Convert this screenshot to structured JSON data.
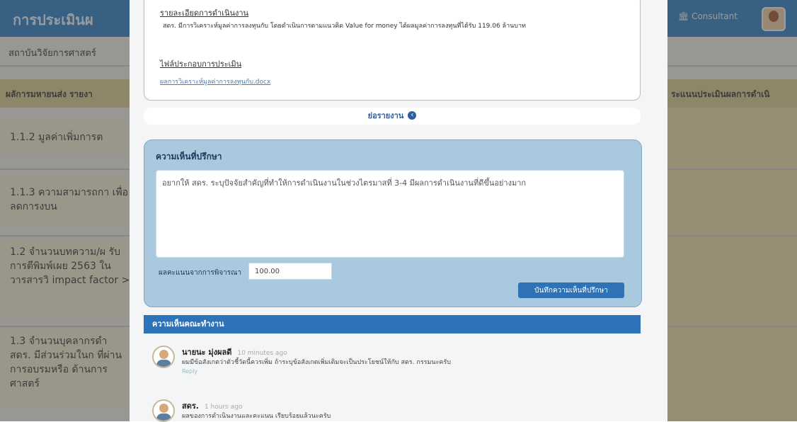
{
  "background": {
    "header_title": "การประเมินผ",
    "user_label": "Consultant",
    "subtitle": "สถาบันวิจัยการศาสตร์",
    "band_left": "ผลัการมหายนส่ง รายงา",
    "band_right": "ระแนนประเมินผลการดำเนิ",
    "rows": [
      {
        "text": "1.1.2 มูลค่าเพิ่มการต"
      },
      {
        "text": "1.1.3 ความสามารถกา เพื่อลดการงบน"
      },
      {
        "text": "1.2 จำนวนบทความ/ผ รับการตีพิมพ์เผย 2563 ในวารสารวิ impact factor >"
      },
      {
        "text": "1.3 จำนวนบุคลากรดำ สดร. มีส่วนร่วมในก ที่ผ่านการอบรมหรือ ด้านการศาสตร์"
      }
    ]
  },
  "modal": {
    "result_label": "รายละเอียดการดำเนินงาน",
    "result_text": "สดร. มีการวิเคราะห์มูลค่าการลงทุนกับ โดยดำเนินการตามแนวคิด Value for money ได้ผลมูลค่าการลงทุนที่ได้รับ 119.06 ล้านบาท",
    "attachment_label": "ไฟล์ประกอบการประเมิน",
    "attachment_link": "ผลการวิเคราะห์มูลค่าการลงทุนกับ.docx",
    "hide_report": "ย่อรายงาน",
    "consultant_title": "ความเห็นที่ปรึกษา",
    "consultant_comment": "อยากให้ สดร. ระบุปัจจัยสำคัญที่ทำให้การดำเนินงานในช่วงไตรมาสที่ 3-4 มีผลการดำเนินงานที่ดีขึ้นอย่างมาก",
    "score_label": "ผลคะแนนจากการพิจารณา",
    "score_value": "100.00",
    "save_button": "บันทึกความเห็นที่ปรึกษา",
    "committee_header": "ความเห็นคณะทำงาน",
    "comments": [
      {
        "name": "นายนะ มุ่งผลดี",
        "time": "10 minutes ago",
        "text": "ผมมีข้อสังเกตว่าตัวชี้วัดนี้ควรเพิ่ม ถ้าระบุข้อสังเกตเพิ่มเติมจะเป็นประโยชน์ให้กับ สดร. กรรมนะครับ",
        "reply": "Reply"
      },
      {
        "name": "สดร.",
        "time": "1 hours ago",
        "text": "ผลของการดำเนินงานและคะแนน เรียบร้อยแล้วนะครับ",
        "reply": "Reply"
      }
    ]
  }
}
